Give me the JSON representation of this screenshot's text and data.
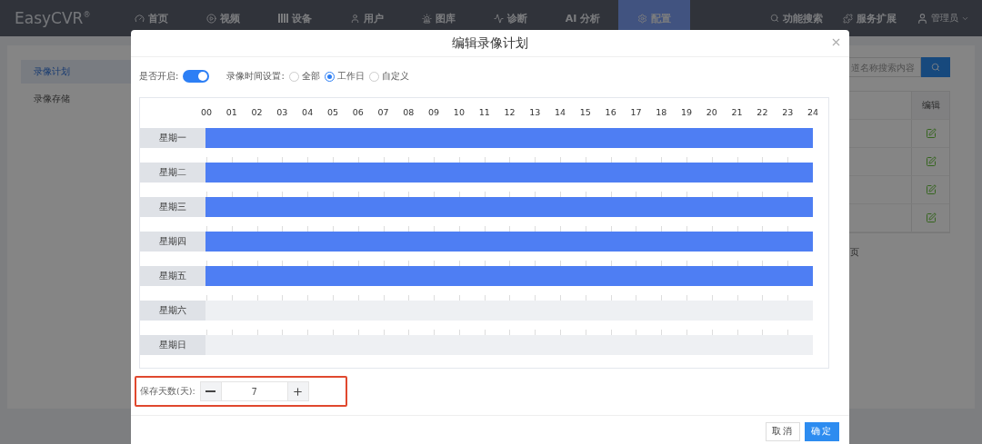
{
  "nav": {
    "logo": "EasyCVR",
    "logo_mark": "®",
    "items": [
      {
        "label": "首页",
        "selected": false
      },
      {
        "label": "视频",
        "selected": false
      },
      {
        "label": "设备",
        "selected": false
      },
      {
        "label": "用户",
        "selected": false
      },
      {
        "label": "图库",
        "selected": false
      },
      {
        "label": "诊断",
        "selected": false
      },
      {
        "label": "AI 分析",
        "selected": false
      },
      {
        "label": "配置",
        "selected": true
      }
    ],
    "search": "功能搜索",
    "extensions": "服务扩展",
    "user": "管理员"
  },
  "sidebar": {
    "items": [
      {
        "label": "录像计划",
        "selected": true
      },
      {
        "label": "录像存储",
        "selected": false
      }
    ]
  },
  "content": {
    "search_placeholder": "道名称搜索内容",
    "edit_header": "编辑",
    "rows": [
      {
        "kind": "editable"
      },
      {
        "kind": "editable"
      },
      {
        "kind": "editable"
      },
      {
        "kind": "editable"
      }
    ],
    "pager_fragment": "页"
  },
  "dialog": {
    "title": "编辑录像计划",
    "enable_label": "是否开启:",
    "enabled": true,
    "time_label": "录像时间设置:",
    "time_options": [
      {
        "label": "全部",
        "selected": false
      },
      {
        "label": "工作日",
        "selected": true
      },
      {
        "label": "自定义",
        "selected": false
      }
    ],
    "hours": [
      "00",
      "01",
      "02",
      "03",
      "04",
      "05",
      "06",
      "07",
      "08",
      "09",
      "10",
      "11",
      "12",
      "13",
      "14",
      "15",
      "16",
      "17",
      "18",
      "19",
      "20",
      "21",
      "22",
      "23",
      "24"
    ],
    "days": [
      {
        "label": "星期一",
        "recording": true
      },
      {
        "label": "星期二",
        "recording": true
      },
      {
        "label": "星期三",
        "recording": true
      },
      {
        "label": "星期四",
        "recording": true
      },
      {
        "label": "星期五",
        "recording": true
      },
      {
        "label": "星期六",
        "recording": false
      },
      {
        "label": "星期日",
        "recording": false
      }
    ],
    "retention": {
      "label": "保存天数(天):",
      "value": "7",
      "highlighted": true
    },
    "buttons": [
      {
        "label": "取消",
        "kind": "secondary"
      },
      {
        "label": "确定",
        "kind": "primary"
      }
    ]
  }
}
